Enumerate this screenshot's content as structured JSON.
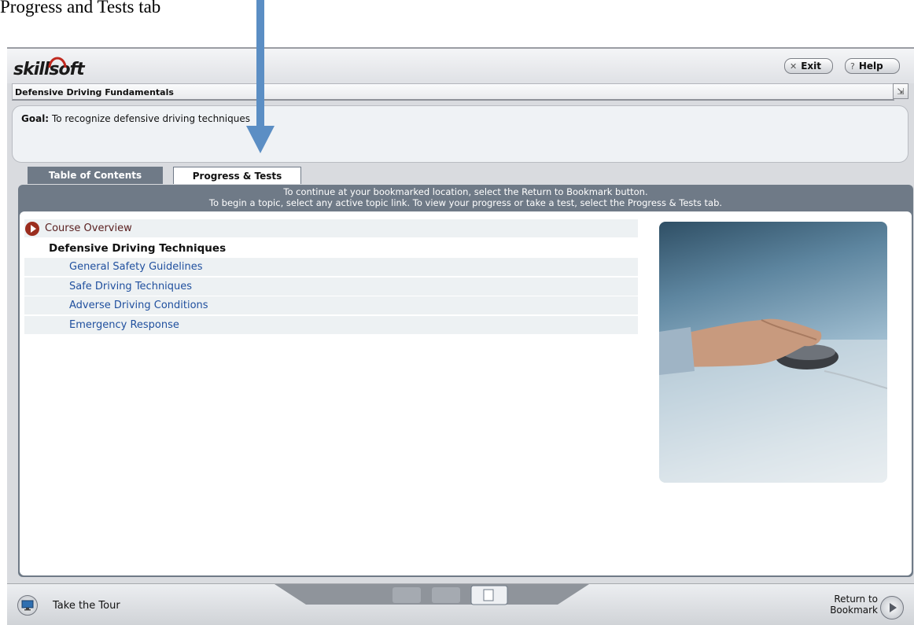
{
  "annotation": {
    "caption": "Progress and Tests tab",
    "arrow_icon": "down-arrow-icon",
    "arrow_color": "#5b8ec4"
  },
  "header": {
    "logo_text": "skillsoft",
    "exit_label": "Exit",
    "help_label": "Help",
    "exit_icon": "close-icon",
    "help_icon": "question-icon"
  },
  "course": {
    "title": "Defensive Driving Fundamentals",
    "expand_icon": "expand-icon"
  },
  "goal": {
    "label": "Goal:",
    "text": "To recognize defensive driving techniques"
  },
  "tabs": [
    {
      "label": "Table of Contents",
      "active": true
    },
    {
      "label": "Progress & Tests",
      "active": false
    }
  ],
  "instructions": {
    "line1": "To continue at your bookmarked location, select the Return to Bookmark button.",
    "line2": "To begin a topic, select any active topic link. To view your progress or take a test, select the Progress & Tests tab."
  },
  "toc": {
    "overview": "Course Overview",
    "section": "Defensive Driving Techniques",
    "topics": [
      "General Safety Guidelines",
      "Safe Driving Techniques",
      "Adverse Driving Conditions",
      "Emergency Response"
    ]
  },
  "footer": {
    "tour_label": "Take the Tour",
    "bookmark_line1": "Return to",
    "bookmark_line2": "Bookmark",
    "tools_icons": [
      "notes-icon",
      "captions-icon",
      "resources-icon"
    ]
  },
  "colors": {
    "panel": "#6f7a87",
    "topic_link": "#1f4f9e",
    "row_shade": "#edf1f3",
    "overview_icon": "#9b2d1e"
  }
}
